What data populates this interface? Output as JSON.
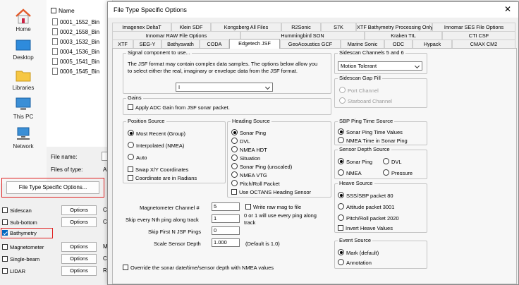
{
  "places": [
    {
      "label": "Home",
      "icon": "home-icon"
    },
    {
      "label": "Desktop",
      "icon": "desktop-icon"
    },
    {
      "label": "Libraries",
      "icon": "folder-icon"
    },
    {
      "label": "This PC",
      "icon": "monitor-icon"
    },
    {
      "label": "Network",
      "icon": "network-icon"
    }
  ],
  "files": {
    "header": "Name",
    "items": [
      "0001_1552_Bin",
      "0002_1558_Bin",
      "0003_1532_Bin",
      "0004_1536_Bin",
      "0005_1541_Bin",
      "0006_1545_Bin"
    ]
  },
  "filename_label": "File name:",
  "filetype_label": "Files of type:",
  "filetype_value": "All",
  "file_type_options_button": "File Type Specific Options...",
  "sidebar_options": [
    {
      "label": "Sidescan",
      "checked": false,
      "button": "Options",
      "suffix": "Ch"
    },
    {
      "label": "Sub-bottom",
      "checked": false,
      "button": "Options",
      "suffix": "Ch"
    },
    {
      "label": "Bathymetry",
      "checked": true,
      "button": "",
      "suffix": ""
    },
    {
      "label": "Magnetometer",
      "checked": false,
      "button": "Options",
      "suffix": "Ma"
    },
    {
      "label": "Single-beam",
      "checked": false,
      "button": "Options",
      "suffix": "Ch"
    },
    {
      "label": "LIDAR",
      "checked": false,
      "button": "Options",
      "suffix": "Ra"
    }
  ],
  "dialog": {
    "title": "File Type Specific Options",
    "close": "✕",
    "tabs_row1": [
      "Imagenex DeltaT",
      "Klein SDF",
      "Kongsberg All Files",
      "R2Sonic",
      "S7K",
      "XTF Bathymetry Processing Only",
      "Innomar SES File Options"
    ],
    "tabs_row2": [
      "Innomar RAW File Options",
      "Hummingbird SON",
      "Kraken TIL",
      "CTI CSF"
    ],
    "tabs_row3": [
      "XTF",
      "SEG-Y",
      "Bathyswath",
      "CODA",
      "Edgetech JSF",
      "GeoAcoustics GCF",
      "Marine Sonic",
      "ODC",
      "Hypack",
      "CMAX CM2"
    ],
    "signal": {
      "title": "Signal component to use...",
      "desc1": "The JSF format may contain complex data samples.  The options below allow you",
      "desc2": "to select either the real, imaginary or envelope data from the JSF format.",
      "value": "I"
    },
    "gains": {
      "title": "Gains",
      "apply": "Apply ADC Gain from JSF sonar packet."
    },
    "position": {
      "title": "Position Source",
      "options": [
        "Most Recent (Group)",
        "Interpolated (NMEA)",
        "Auto"
      ],
      "selected": 0,
      "swap": "Swap X/Y Coordinates",
      "radians": "Coordinate are in Radians"
    },
    "heading": {
      "title": "Heading Source",
      "options": [
        "Sonar Ping",
        "DVL",
        "NMEA HDT",
        "Situation",
        "Sonar Ping (unscaled)",
        "NMEA VTG",
        "Pitch/Roll Packet"
      ],
      "selected": 0,
      "octans": "Use OCTANS Heading Sensor"
    },
    "sidescan56": {
      "title": "Sidescan Channels 5 and 6",
      "value": "Motion Tolerant"
    },
    "gapfill": {
      "title": "Sidescan Gap Fill",
      "options": [
        "Port Channel",
        "Starboard Channel"
      ]
    },
    "sbp": {
      "title": "SBP Ping Time Source",
      "options": [
        "Sonar Ping Time Values",
        "NMEA Time in Sonar Ping"
      ],
      "selected": 0
    },
    "depth": {
      "title": "Sensor Depth Source",
      "options": [
        "Sonar Ping",
        "DVL",
        "NMEA",
        "Pressure"
      ],
      "selected": 0
    },
    "heave": {
      "title": "Heave Source",
      "options": [
        "SSS/SBP packet 80",
        "Attitude packet 3001",
        "Pitch/Roll packet 2020"
      ],
      "selected": 0,
      "invert": "Invert Heave Values"
    },
    "event": {
      "title": "Event Source",
      "options": [
        "Mark (default)",
        "Annotation"
      ],
      "selected": 0
    },
    "mag_label": "Magnetometer Channel #",
    "mag_value": "5",
    "write_raw": "Write raw mag to file",
    "skip_label": "Skip every Nth ping along track",
    "skip_value": "1",
    "skip_note1": "0 or 1 will use every ping along",
    "skip_note2": "track",
    "skipfirst_label": "Skip First N JSF Pings",
    "skipfirst_value": "0",
    "scale_label": "Scale Sensor Depth",
    "scale_value": "1.000",
    "scale_note": "(Default is 1.0)",
    "override": "Override the sonar date/time/sensor depth with NMEA values"
  },
  "colors": {
    "accent": "#0067c0",
    "annotation": "#e02020"
  }
}
